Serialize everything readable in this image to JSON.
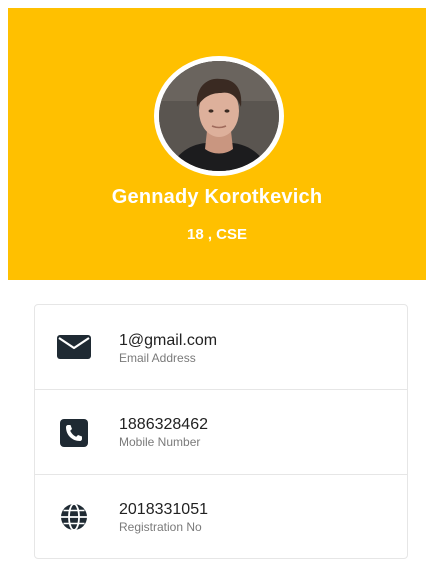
{
  "colors": {
    "header_bg": "#FFC000",
    "header_text": "#FFFFFF",
    "icon": "#1F2A33",
    "label": "#7A7A7A"
  },
  "profile": {
    "name": "Gennady Korotkevich",
    "subtitle": "18 , CSE"
  },
  "details": [
    {
      "icon": "envelope-icon",
      "value": "1@gmail.com",
      "label": "Email Address"
    },
    {
      "icon": "phone-icon",
      "value": "1886328462",
      "label": "Mobile Number"
    },
    {
      "icon": "globe-icon",
      "value": "2018331051",
      "label": "Registration No"
    }
  ]
}
